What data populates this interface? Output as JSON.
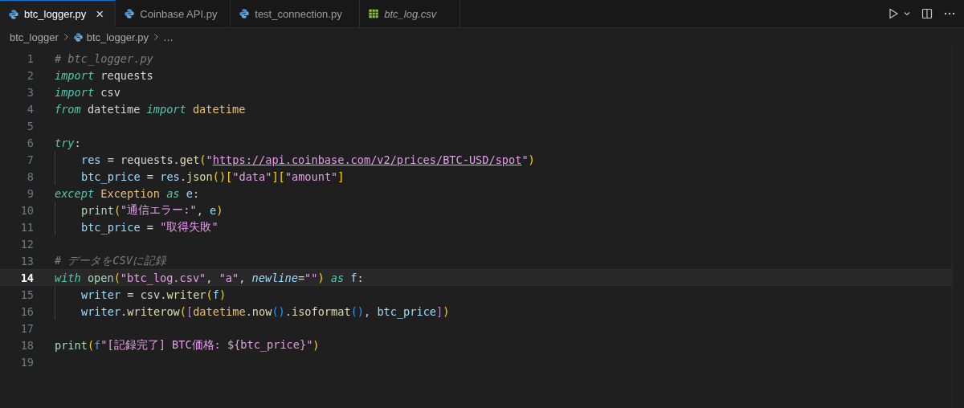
{
  "tabs": [
    {
      "label": "btc_logger.py",
      "kind": "python",
      "selected": true,
      "preview": false,
      "close": "×"
    },
    {
      "label": "Coinbase API.py",
      "kind": "python",
      "selected": false,
      "preview": false
    },
    {
      "label": "test_connection.py",
      "kind": "python",
      "selected": false,
      "preview": false
    },
    {
      "label": "btc_log.csv",
      "kind": "csv",
      "selected": false,
      "preview": true
    }
  ],
  "breadcrumbs": [
    {
      "label": "btc_logger",
      "kind": "folder"
    },
    {
      "label": "btc_logger.py",
      "kind": "python"
    },
    {
      "label": "…",
      "kind": "more"
    }
  ],
  "lines": [
    {
      "number": "1",
      "current": false,
      "tokens": [
        {
          "kind": "comment",
          "text": "# btc_logger.py"
        }
      ]
    },
    {
      "number": "2",
      "current": false,
      "tokens": [
        {
          "kind": "keyword",
          "text": "import"
        },
        {
          "kind": "plain",
          "text": " requests"
        }
      ]
    },
    {
      "number": "3",
      "current": false,
      "tokens": [
        {
          "kind": "keyword",
          "text": "import"
        },
        {
          "kind": "plain",
          "text": " csv"
        }
      ]
    },
    {
      "number": "4",
      "current": false,
      "tokens": [
        {
          "kind": "keyword",
          "text": "from"
        },
        {
          "kind": "plain",
          "text": " datetime "
        },
        {
          "kind": "keyword",
          "text": "import"
        },
        {
          "kind": "class",
          "text": " datetime"
        }
      ]
    },
    {
      "number": "5",
      "current": false
    },
    {
      "number": "6",
      "current": false,
      "tokens": [
        {
          "kind": "keyword",
          "text": "try"
        },
        {
          "kind": "plain",
          "text": ":"
        }
      ]
    },
    {
      "number": "7",
      "current": false,
      "indented": true,
      "tokens": [
        {
          "kind": "variable",
          "text": "res"
        },
        {
          "kind": "plain",
          "text": " = requests."
        },
        {
          "kind": "function",
          "text": "get"
        },
        {
          "kind": "bracket1",
          "text": "("
        },
        {
          "kind": "string",
          "text": "\""
        },
        {
          "kind": "url",
          "text": "https://api.coinbase.com/v2/prices/BTC-USD/spot"
        },
        {
          "kind": "string",
          "text": "\""
        },
        {
          "kind": "bracket1",
          "text": ")"
        }
      ]
    },
    {
      "number": "8",
      "current": false,
      "indented": true,
      "tokens": [
        {
          "kind": "variable",
          "text": "btc_price"
        },
        {
          "kind": "plain",
          "text": " = "
        },
        {
          "kind": "variable",
          "text": "res"
        },
        {
          "kind": "plain",
          "text": "."
        },
        {
          "kind": "function",
          "text": "json"
        },
        {
          "kind": "bracket1",
          "text": "()["
        },
        {
          "kind": "string",
          "text": "\"data\""
        },
        {
          "kind": "bracket1",
          "text": "]["
        },
        {
          "kind": "string",
          "text": "\"amount\""
        },
        {
          "kind": "bracket1",
          "text": "]"
        }
      ]
    },
    {
      "number": "9",
      "current": false,
      "tokens": [
        {
          "kind": "keyword",
          "text": "except"
        },
        {
          "kind": "class",
          "text": " Exception "
        },
        {
          "kind": "keyword",
          "text": "as"
        },
        {
          "kind": "variable",
          "text": " e"
        },
        {
          "kind": "plain",
          "text": ":"
        }
      ]
    },
    {
      "number": "10",
      "current": false,
      "indented": true,
      "tokens": [
        {
          "kind": "builtin",
          "text": "print"
        },
        {
          "kind": "bracket1",
          "text": "("
        },
        {
          "kind": "string",
          "text": "\"通信エラー:\""
        },
        {
          "kind": "plain",
          "text": ", "
        },
        {
          "kind": "variable",
          "text": "e"
        },
        {
          "kind": "bracket1",
          "text": ")"
        }
      ]
    },
    {
      "number": "11",
      "current": false,
      "indented": true,
      "tokens": [
        {
          "kind": "variable",
          "text": "btc_price"
        },
        {
          "kind": "plain",
          "text": " = "
        },
        {
          "kind": "string",
          "text": "\"取得失敗\""
        }
      ]
    },
    {
      "number": "12",
      "current": false
    },
    {
      "number": "13",
      "current": false,
      "tokens": [
        {
          "kind": "comment",
          "text": "# データをCSVに記録"
        }
      ]
    },
    {
      "number": "14",
      "current": true,
      "tokens": [
        {
          "kind": "keyword",
          "text": "with"
        },
        {
          "kind": "builtin",
          "text": " open"
        },
        {
          "kind": "bracket1",
          "text": "("
        },
        {
          "kind": "string",
          "text": "\"btc_log.csv\""
        },
        {
          "kind": "plain",
          "text": ", "
        },
        {
          "kind": "string",
          "text": "\"a\""
        },
        {
          "kind": "plain",
          "text": ", "
        },
        {
          "kind": "param",
          "text": "newline"
        },
        {
          "kind": "plain",
          "text": "="
        },
        {
          "kind": "string",
          "text": "\"\""
        },
        {
          "kind": "bracket1",
          "text": ")"
        },
        {
          "kind": "keyword",
          "text": " as"
        },
        {
          "kind": "variable",
          "text": " f"
        },
        {
          "kind": "plain",
          "text": ":"
        }
      ]
    },
    {
      "number": "15",
      "current": false,
      "indented": true,
      "tokens": [
        {
          "kind": "variable",
          "text": "writer"
        },
        {
          "kind": "plain",
          "text": " = csv."
        },
        {
          "kind": "function",
          "text": "writer"
        },
        {
          "kind": "bracket1",
          "text": "("
        },
        {
          "kind": "variable",
          "text": "f"
        },
        {
          "kind": "bracket1",
          "text": ")"
        }
      ]
    },
    {
      "number": "16",
      "current": false,
      "indented": true,
      "tokens": [
        {
          "kind": "variable",
          "text": "writer"
        },
        {
          "kind": "plain",
          "text": "."
        },
        {
          "kind": "function",
          "text": "writerow"
        },
        {
          "kind": "bracket1",
          "text": "("
        },
        {
          "kind": "bracket2",
          "text": "["
        },
        {
          "kind": "class",
          "text": "datetime"
        },
        {
          "kind": "plain",
          "text": "."
        },
        {
          "kind": "function",
          "text": "now"
        },
        {
          "kind": "bracket3",
          "text": "()"
        },
        {
          "kind": "plain",
          "text": "."
        },
        {
          "kind": "function",
          "text": "isoformat"
        },
        {
          "kind": "bracket3",
          "text": "()"
        },
        {
          "kind": "plain",
          "text": ", "
        },
        {
          "kind": "variable",
          "text": "btc_price"
        },
        {
          "kind": "bracket2",
          "text": "]"
        },
        {
          "kind": "bracket1",
          "text": ")"
        }
      ]
    },
    {
      "number": "17",
      "current": false
    },
    {
      "number": "18",
      "current": false,
      "tokens": [
        {
          "kind": "builtin",
          "text": "print"
        },
        {
          "kind": "bracket1",
          "text": "("
        },
        {
          "kind": "prefix",
          "text": "f"
        },
        {
          "kind": "string",
          "text": "\"[記録完了] BTC価格: ${btc_price}\""
        },
        {
          "kind": "bracket1",
          "text": ")"
        }
      ]
    },
    {
      "number": "19",
      "current": false
    }
  ]
}
